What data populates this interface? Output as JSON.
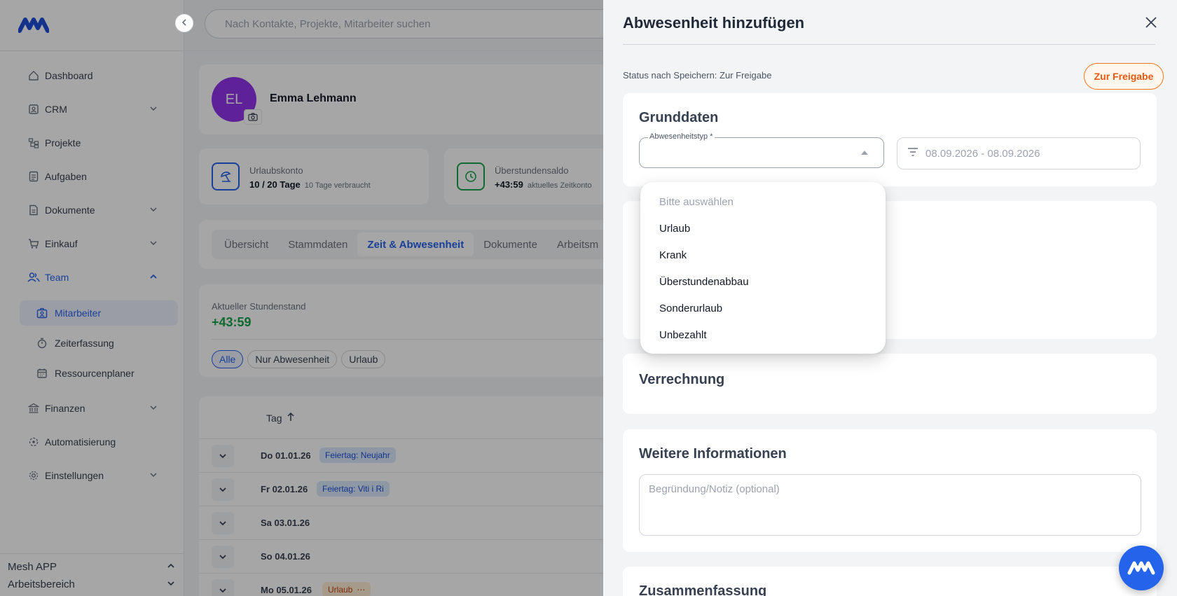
{
  "search": {
    "placeholder": "Nach Kontakte, Projekte, Mitarbeiter suchen"
  },
  "sidebar": {
    "items": [
      {
        "label": "Dashboard"
      },
      {
        "label": "CRM"
      },
      {
        "label": "Projekte"
      },
      {
        "label": "Aufgaben"
      },
      {
        "label": "Dokumente"
      },
      {
        "label": "Einkauf"
      },
      {
        "label": "Team"
      },
      {
        "label": "Finanzen"
      },
      {
        "label": "Automatisierung"
      },
      {
        "label": "Einstellungen"
      }
    ],
    "team_sub": [
      {
        "label": "Mitarbeiter"
      },
      {
        "label": "Zeiterfassung"
      },
      {
        "label": "Ressourcenplaner"
      }
    ],
    "app_name": "Mesh APP",
    "workspace": "Arbeitsbereich"
  },
  "profile": {
    "initials": "EL",
    "name": "Emma Lehmann"
  },
  "stats": {
    "vacation": {
      "title": "Urlaubskonto",
      "value": "10 / 20 Tage",
      "note": "10 Tage verbraucht"
    },
    "overtime": {
      "title": "Überstundensaldo",
      "value": "+43:59",
      "note": "aktuelles Zeitkonto"
    }
  },
  "tabs": [
    "Übersicht",
    "Stammdaten",
    "Zeit & Abwesenheit",
    "Dokumente",
    "Arbeitsm"
  ],
  "hours": {
    "label": "Aktueller Stundenstand",
    "value": "+43:59"
  },
  "filters": [
    "Alle",
    "Nur Abwesenheit",
    "Urlaub"
  ],
  "table": {
    "header": "Tag",
    "rows": [
      {
        "day": "Do 01.01.26",
        "badge": "Feiertag: Neujahr"
      },
      {
        "day": "Fr 02.01.26",
        "badge": "Feiertag: Viti i Ri"
      },
      {
        "day": "Sa 03.01.26",
        "badge": ""
      },
      {
        "day": "So 04.01.26",
        "badge": ""
      },
      {
        "day": "Mo 05.01.26",
        "badge": "Urlaub",
        "badge_extra": "⋯"
      }
    ]
  },
  "drawer": {
    "title": "Abwesenheit hinzufügen",
    "status_text": "Status nach Speichern: Zur Freigabe",
    "status_button": "Zur Freigabe",
    "sections": {
      "grunddaten": "Grunddaten",
      "verrechnung": "Verrechnung",
      "weitere": "Weitere Informationen",
      "zusammenfassung": "Zusammenfassung"
    },
    "type_label": "Abwesenheitstyp *",
    "date_range": "08.09.2026 - 08.09.2026",
    "note_placeholder": "Begründung/Notiz (optional)",
    "dropdown_options": [
      "Bitte auswählen",
      "Urlaub",
      "Krank",
      "Überstundenabbau",
      "Sonderurlaub",
      "Unbezahlt"
    ]
  },
  "colors": {
    "accent": "#2563eb",
    "avatar": "#9333ea",
    "positive": "#16a34a",
    "status": "#ea580c"
  }
}
